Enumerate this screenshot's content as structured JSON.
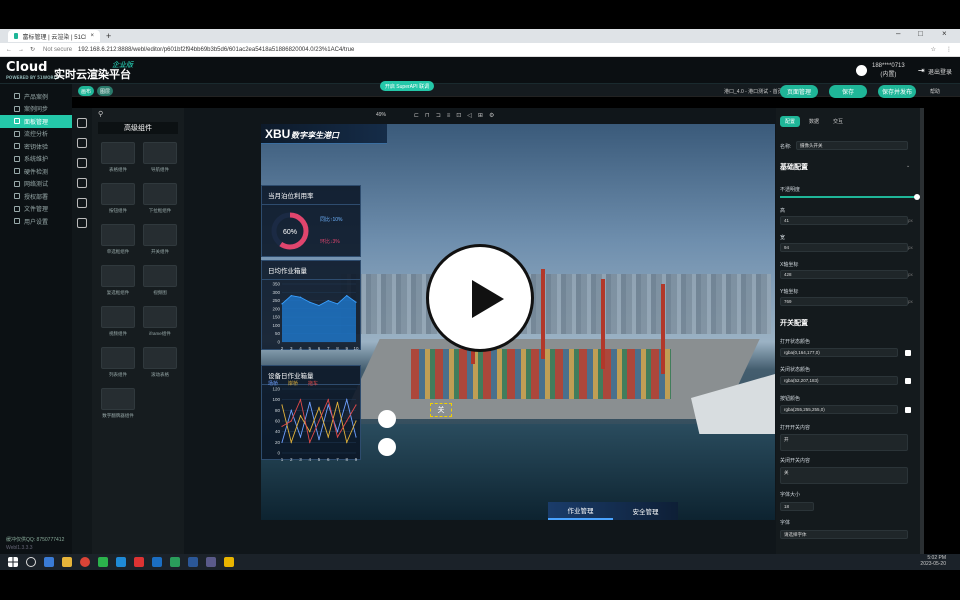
{
  "browser": {
    "tab_title": "富标管理 | 云渲染 | 51Cloud数…",
    "url_prefix": "Not secure",
    "url": "192.168.6.212:8888/webl/editor/p601bf2f94bb69b3b5d6/601ac2ea5418a51886820004.0/23%1AC4/true",
    "back_icon": "arrow-left-icon",
    "forward_icon": "arrow-right-icon",
    "reload_icon": "reload-icon"
  },
  "app": {
    "logo_text": "Cloud",
    "logo_sub": "POWERED BY 51WORLD",
    "brand": "实时云渲染平台",
    "edition": "企业版",
    "user_name": "188****0713",
    "user_role": "(内置)",
    "logout": "退出登录"
  },
  "sidebar": {
    "items": [
      {
        "label": "产品案例"
      },
      {
        "label": "案例同步"
      },
      {
        "label": "面板管理",
        "active": true
      },
      {
        "label": "流控分析"
      },
      {
        "label": "密钥体验"
      },
      {
        "label": "系统维护"
      },
      {
        "label": "硬件检测"
      },
      {
        "label": "网络测试"
      },
      {
        "label": "授权部署"
      },
      {
        "label": "文件管理"
      },
      {
        "label": "用户设置"
      }
    ],
    "footer_line1": "缓冲仅供QQ: 8750777412",
    "footer_line2": "Webl1.3.3.3"
  },
  "editor": {
    "pill_left1": "画布",
    "pill_left2": "图层",
    "center_pill": "开启 SuperAPI 联调",
    "crumb": "港口_4.0 - 港口测试 - 首页",
    "btn_manage": "页面管理",
    "btn_save": "保存",
    "btn_publish": "保存并发布",
    "help": "帮助",
    "zoom": "49%"
  },
  "components": {
    "title": "高级组件",
    "items": [
      {
        "label": "表格组件"
      },
      {
        "label": "导航组件"
      },
      {
        "label": "按钮组件"
      },
      {
        "label": "下拉框组件"
      },
      {
        "label": "单选框组件"
      },
      {
        "label": "开关组件"
      },
      {
        "label": "复选框组件"
      },
      {
        "label": "视频图"
      },
      {
        "label": "视频组件"
      },
      {
        "label": "iframe组件"
      },
      {
        "label": "列表组件"
      },
      {
        "label": "滚动表格"
      },
      {
        "label": "数字翻牌器组件"
      }
    ]
  },
  "scene": {
    "logo": "XBU",
    "title": "数字孪生港口",
    "panel1_title": "当月泊位利用率",
    "panel1_value": "60%",
    "panel1_up": "同比↑10%",
    "panel1_down": "环比↓3%",
    "panel2_title": "日均作业箱量",
    "panel3_title": "设备日作业箱量",
    "switch_label": "关",
    "tab1": "作业管理",
    "tab2": "安全管理"
  },
  "chart_data": [
    {
      "type": "area",
      "x": [
        2,
        3,
        4,
        5,
        6,
        7,
        8,
        9,
        10
      ],
      "values": [
        230,
        280,
        270,
        240,
        220,
        250,
        230,
        280,
        240
      ],
      "ylim": [
        0,
        350
      ],
      "yticks": [
        0,
        50,
        100,
        150,
        200,
        250,
        300,
        350
      ]
    },
    {
      "type": "line",
      "x": [
        1,
        2,
        3,
        4,
        5,
        6,
        7,
        8,
        9
      ],
      "series": [
        {
          "name": "场桥",
          "color": "#6fa0ff",
          "values": [
            20,
            80,
            30,
            95,
            25,
            90,
            40,
            100,
            30
          ]
        },
        {
          "name": "岸桥",
          "color": "#e2b23a",
          "values": [
            90,
            20,
            70,
            40,
            85,
            30,
            95,
            20,
            60
          ]
        },
        {
          "name": "拖车",
          "color": "#e04a4a",
          "values": [
            50,
            60,
            100,
            20,
            60,
            100,
            30,
            60,
            90
          ]
        }
      ],
      "ylim": [
        0,
        120
      ],
      "yticks": [
        0,
        20,
        40,
        60,
        80,
        100,
        120
      ]
    }
  ],
  "props": {
    "tabs": [
      "配置",
      "数据",
      "交互"
    ],
    "name_label": "名称:",
    "name_value": "摄像头开关",
    "basic": "基础配置",
    "opacity": "不透明度",
    "height_label": "高",
    "height_value": "41",
    "width_label": "宽",
    "width_value": "94",
    "x_label": "X轴坐标",
    "x_value": "428",
    "y_label": "Y轴坐标",
    "y_value": "769",
    "switch_cfg": "开关配置",
    "on_color_label": "打开状态颜色",
    "on_color": "rgba(0,164,177,0)",
    "off_color_label": "关闭状态颜色",
    "off_color": "rgba(52,207,183)",
    "btn_color_label": "按钮颜色",
    "btn_color": "rgba(255,255,255,0)",
    "on_text_label": "打开开关内容",
    "on_text": "开",
    "off_text_label": "关闭开关内容",
    "off_text": "关",
    "font_size_label": "字体大小",
    "font_size": "18",
    "font_label": "字体",
    "font_value": "请选择字体",
    "unit": "px"
  },
  "taskbar": {
    "time": "5:02 PM",
    "date": "2023-05-20"
  }
}
